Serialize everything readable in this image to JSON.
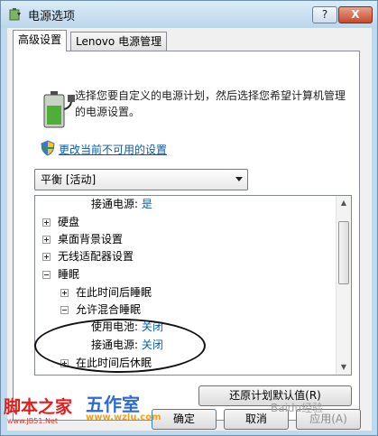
{
  "window": {
    "title": "电源选项",
    "help_label": "?",
    "close_label": "X"
  },
  "tabs": [
    {
      "label": "高级设置",
      "active": true
    },
    {
      "label": "Lenovo 电源管理",
      "active": false
    }
  ],
  "panel": {
    "description": "选择您要自定义的电源计划，然后选择您希望计算机管理的电源设置。",
    "change_link": "更改当前不可用的设置",
    "plan_select_value": "平衡 [活动]"
  },
  "tree": {
    "rows": [
      {
        "label": "接通电源:",
        "value": "是"
      },
      {
        "label": "硬盘"
      },
      {
        "label": "桌面背景设置"
      },
      {
        "label": "无线适配器设置"
      },
      {
        "label": "睡眠"
      },
      {
        "label": "在此时间后睡眠"
      },
      {
        "label": "允许混合睡眠"
      },
      {
        "label": "使用电池:",
        "value": "关闭"
      },
      {
        "label": "接通电源:",
        "value": "关闭"
      },
      {
        "label": "在此时间后休眠"
      }
    ]
  },
  "buttons": {
    "restore": "还原计划默认值(R)",
    "ok": "确定",
    "cancel": "取消",
    "apply": "应用(A)"
  },
  "watermarks": {
    "jb51": "脚本之家",
    "jb51_url": "www.JB51.Net",
    "wz": "五作室",
    "wz_url": "www.wzlu.com",
    "baidu": "Baidu经验"
  },
  "colors": {
    "link": "#0b5ba8",
    "window_frame": "#bfd9ee"
  }
}
